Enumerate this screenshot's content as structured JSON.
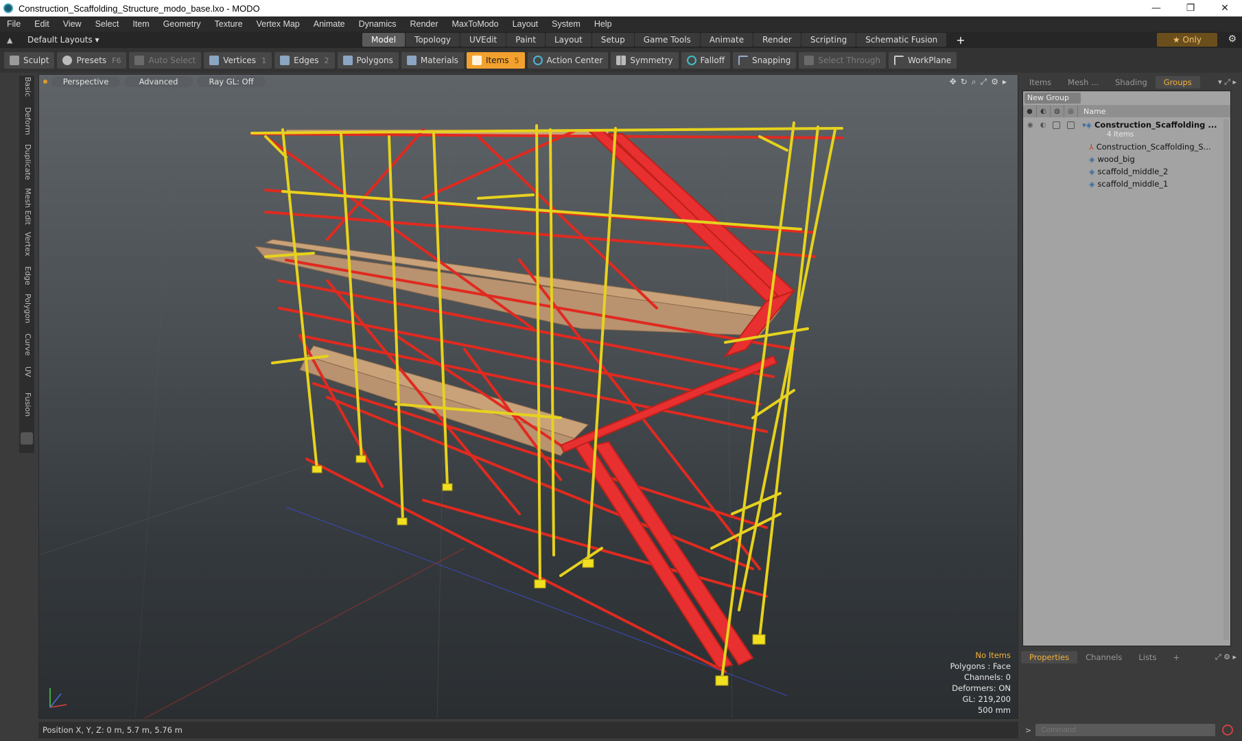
{
  "window": {
    "title": "Construction_Scaffolding_Structure_modo_base.lxo - MODO",
    "controls": [
      "—",
      "❐",
      "✕"
    ]
  },
  "menubar": [
    "File",
    "Edit",
    "View",
    "Select",
    "Item",
    "Geometry",
    "Texture",
    "Vertex Map",
    "Animate",
    "Dynamics",
    "Render",
    "MaxToModo",
    "Layout",
    "System",
    "Help"
  ],
  "layoutbar": {
    "layouts_label": "Default Layouts ▾",
    "tabs": [
      "Model",
      "Topology",
      "UVEdit",
      "Paint",
      "Layout",
      "Setup",
      "Game Tools",
      "Animate",
      "Render",
      "Scripting",
      "Schematic Fusion"
    ],
    "active_tab": "Model",
    "plus": "+",
    "only_label": "★  Only"
  },
  "toolbar": {
    "sculpt": "Sculpt",
    "presets": "Presets",
    "presets_key": "F6",
    "auto_select": "Auto Select",
    "vertices": "Vertices",
    "vertices_key": "1",
    "edges": "Edges",
    "edges_key": "2",
    "polygons": "Polygons",
    "materials": "Materials",
    "items": "Items",
    "items_key": "5",
    "action_center": "Action Center",
    "symmetry": "Symmetry",
    "falloff": "Falloff",
    "snapping": "Snapping",
    "select_through": "Select Through",
    "workplane": "WorkPlane"
  },
  "left_tabs": [
    "Basic",
    "Deform",
    "Duplicate",
    "Mesh Edit",
    "Vertex",
    "Edge",
    "Polygon",
    "Curve",
    "UV",
    "Fusion"
  ],
  "viewport": {
    "view": "Perspective",
    "shading": "Advanced",
    "raygl": "Ray GL: Off",
    "info": {
      "selection": "No Items",
      "polygons": "Polygons : Face",
      "channels": "Channels: 0",
      "deformers": "Deformers: ON",
      "gl": "GL: 219,200",
      "scale": "500 mm"
    }
  },
  "statusbar": {
    "position": "Position X, Y, Z:   0 m, 5.7 m, 5.76 m"
  },
  "right_panel": {
    "tabs": [
      "Items",
      "Mesh ...",
      "Shading",
      "Groups"
    ],
    "active_tab": "Groups",
    "new_group": "New Group",
    "column_name": "Name",
    "tree": [
      {
        "label": "Construction_Scaffolding ...",
        "bold": true
      },
      {
        "label": "4 Items",
        "sub": true
      },
      {
        "label": "Construction_Scaffolding_S..."
      },
      {
        "label": "wood_big"
      },
      {
        "label": "scaffold_middle_2"
      },
      {
        "label": "scaffold_middle_1"
      }
    ],
    "bottom_tabs": [
      "Properties",
      "Channels",
      "Lists"
    ],
    "bottom_active": "Properties",
    "bottom_plus": "+",
    "command_placeholder": "Command",
    "command_prompt": ">"
  },
  "colors": {
    "accent": "#f2a12e",
    "scaffold_yellow": "#e6d21e",
    "brace_red": "#e02a20",
    "plank": "#c9a27a"
  }
}
